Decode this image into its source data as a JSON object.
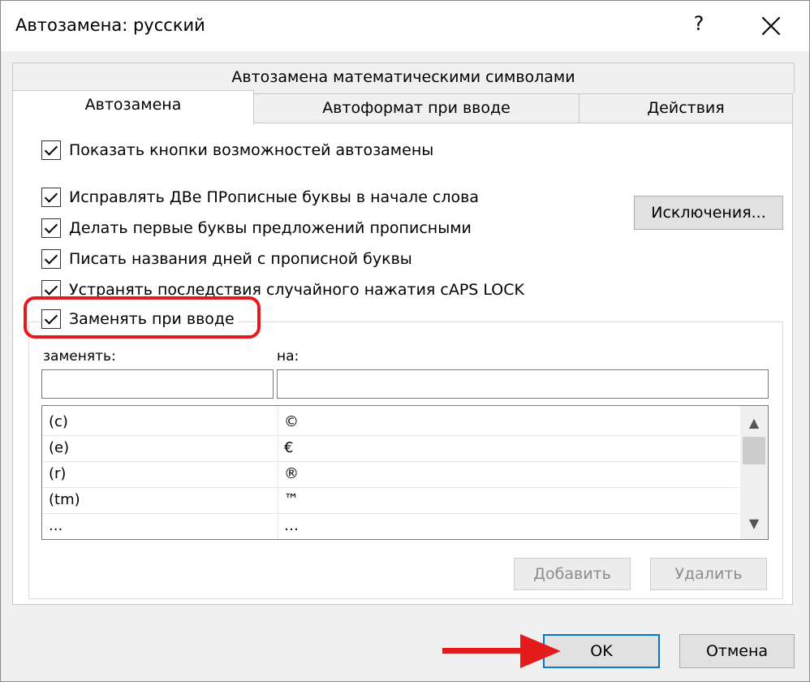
{
  "window": {
    "title": "Автозамена: русский",
    "help_label": "?",
    "close_icon": "close-icon"
  },
  "tabs": {
    "row1": [
      "Автозамена математическими символами"
    ],
    "row2": [
      "Автозамена",
      "Автоформат при вводе",
      "Действия"
    ],
    "active": "Автозамена"
  },
  "options": {
    "show_buttons": "Показать кнопки возможностей автозамены",
    "fix_two_caps": "Исправлять ДВе ПРописные буквы в начале слова",
    "capitalize_sentences": "Делать первые буквы предложений прописными",
    "capitalize_days": "Писать названия дней с прописной буквы",
    "fix_caps_lock": "Устранять последствия случайного нажатия cAPS LOCK",
    "replace_as_you_type": "Заменять при вводе"
  },
  "exceptions_button": "Исключения...",
  "replace_label": "заменять:",
  "with_label": "на:",
  "replace_value": "",
  "with_value": "",
  "list": [
    {
      "replace": "(c)",
      "with": "©"
    },
    {
      "replace": "(e)",
      "with": "€"
    },
    {
      "replace": "(r)",
      "with": "®"
    },
    {
      "replace": "(tm)",
      "with": "™"
    },
    {
      "replace": "...",
      "with": "…"
    }
  ],
  "buttons": {
    "add": "Добавить",
    "delete": "Удалить",
    "ok": "OK",
    "cancel": "Отмена"
  },
  "colors": {
    "highlight": "#e41b1b",
    "ok_border": "#0078d7"
  }
}
